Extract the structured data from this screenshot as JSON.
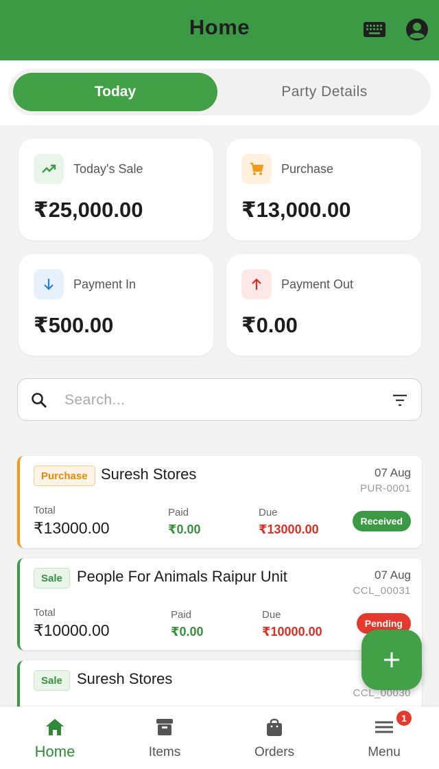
{
  "header": {
    "title": "Home",
    "keyboard_icon": "keyboard-icon",
    "account_icon": "account-circle-icon"
  },
  "tabs": [
    {
      "label": "Today",
      "active": true
    },
    {
      "label": "Party Details",
      "active": false
    }
  ],
  "summary": {
    "sale": {
      "label": "Today's Sale",
      "value": "₹25,000.00",
      "icon": "trending-up-icon",
      "color": "#3c9a45"
    },
    "purchase": {
      "label": "Purchase",
      "value": "₹13,000.00",
      "icon": "cart-icon",
      "color": "#f29a1f"
    },
    "payment_in": {
      "label": "Payment In",
      "value": "₹500.00",
      "icon": "arrow-down-icon",
      "color": "#2a7fd4"
    },
    "payment_out": {
      "label": "Payment Out",
      "value": "₹0.00",
      "icon": "arrow-up-icon",
      "color": "#d93025"
    }
  },
  "search": {
    "placeholder": "Search...",
    "value": ""
  },
  "transactions": [
    {
      "type": "Purchase",
      "party": "Suresh Stores",
      "date": "07 Aug",
      "ref": "PUR-0001",
      "total_label": "Total",
      "total": "₹13000.00",
      "paid_label": "Paid",
      "paid": "₹0.00",
      "due_label": "Due",
      "due": "₹13000.00",
      "status": "Received"
    },
    {
      "type": "Sale",
      "party": "People For Animals Raipur Unit",
      "date": "07 Aug",
      "ref": "CCL_00031",
      "total_label": "Total",
      "total": "₹10000.00",
      "paid_label": "Paid",
      "paid": "₹0.00",
      "due_label": "Due",
      "due": "₹10000.00",
      "status": "Pending"
    },
    {
      "type": "Sale",
      "party": "Suresh Stores",
      "ref": "CCL_00030"
    }
  ],
  "fab": {
    "icon": "plus-icon"
  },
  "bottom_nav": [
    {
      "label": "Home",
      "icon": "home-icon",
      "active": true
    },
    {
      "label": "Items",
      "icon": "archive-icon",
      "active": false
    },
    {
      "label": "Orders",
      "icon": "shopping-bag-icon",
      "active": false
    },
    {
      "label": "Menu",
      "icon": "menu-icon",
      "active": false,
      "badge": "1"
    }
  ],
  "colors": {
    "primary": "#3c9a45",
    "accent_orange": "#f29a1f",
    "danger": "#e5392e"
  }
}
